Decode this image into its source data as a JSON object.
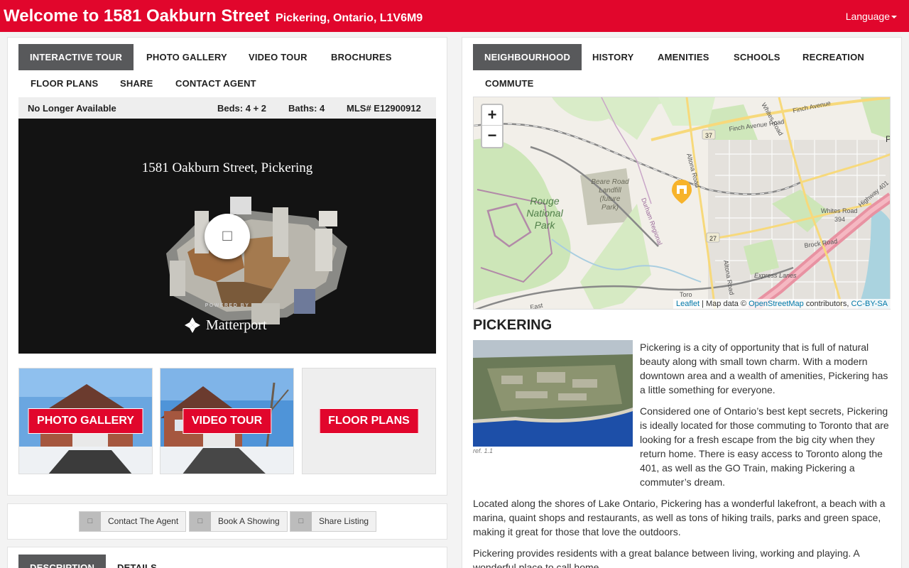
{
  "header": {
    "title": "Welcome to 1581 Oakburn Street",
    "subtitle": "Pickering, Ontario, L1V6M9",
    "language_label": "Language"
  },
  "left_tabs": {
    "interactive_tour": "INTERACTIVE TOUR",
    "photo_gallery": "PHOTO GALLERY",
    "video_tour": "VIDEO TOUR",
    "brochures": "BROCHURES",
    "floor_plans": "FLOOR PLANS",
    "share": "SHARE",
    "contact_agent": "CONTACT AGENT"
  },
  "listing": {
    "status": "No Longer Available",
    "beds": "Beds: 4 + 2",
    "baths": "Baths: 4",
    "mls": "MLS# E12900912"
  },
  "tour": {
    "name": "1581 Oakburn Street, Pickering",
    "powered_by": "POWERED BY",
    "brand": "Matterport",
    "play_icon": "□"
  },
  "thumbs": {
    "photo_gallery": "PHOTO GALLERY",
    "video_tour": "VIDEO TOUR",
    "floor_plans": "FLOOR PLANS"
  },
  "actions": {
    "contact": "Contact The Agent",
    "showing": "Book A Showing",
    "share": "Share Listing",
    "icon_glyph": "□"
  },
  "bottom_tabs": {
    "description": "DESCRIPTION",
    "details": "DETAILS"
  },
  "right_tabs": {
    "neighbourhood": "NEIGHBOURHOOD",
    "history": "HISTORY",
    "amenities": "AMENITIES",
    "schools": "SCHOOLS",
    "recreation": "RECREATION",
    "commute": "COMMUTE"
  },
  "map": {
    "zoom_in": "+",
    "zoom_out": "−",
    "labels": {
      "rouge1": "Rouge",
      "rouge2": "National",
      "rouge3": "Park",
      "beare1": "Beare Road",
      "beare2": "Landfill",
      "beare3": "(future",
      "beare4": "Park)",
      "finch": "Finch Avenue",
      "finch_road": "Finch Avenue Road",
      "whites": "Whites Road",
      "whites_road": "Whites Road",
      "whites_num": "394",
      "highway": "Highway 401",
      "brock": "Brock Road",
      "express": "Express Lanes",
      "durham": "Durham Regional",
      "altona": "Altona Road",
      "altona2": "Altona Road",
      "r37": "37",
      "r27": "27",
      "p": "P",
      "east": "East",
      "toro": "Toro"
    },
    "attribution": {
      "leaflet": "Leaflet",
      "data": "| Map data ©",
      "osm": "OpenStreetMap",
      "contrib": "contributors,",
      "license": "CC-BY-SA"
    }
  },
  "city": {
    "title": "PICKERING",
    "image_ref": "ref. 1.1",
    "p1": "Pickering is a city of opportunity that is full of natural beauty along with small town charm. With a modern downtown area and a wealth of amenities, Pickering has a little something for everyone.",
    "p2": "Considered one of Ontario’s best kept secrets, Pickering is ideally located for those commuting to Toronto that are looking for a fresh escape from the big city when they return home. There is easy access to Toronto along the 401, as well as the GO Train, making Pickering a commuter’s dream.",
    "p3": "Located along the shores of Lake Ontario, Pickering has a wonderful lakefront, a beach with a marina, quaint shops and restaurants, as well as tons of hiking trails, parks and green space, making it great for those that love the outdoors.",
    "p4": "Pickering provides residents with a great balance between living, working and playing. A wonderful place to call home."
  },
  "colors": {
    "brand_red": "#e1062c",
    "tab_active": "#58595b"
  }
}
